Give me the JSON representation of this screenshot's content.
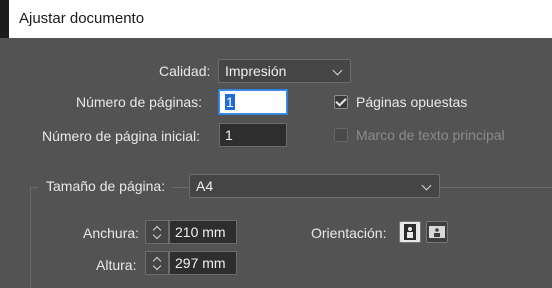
{
  "window": {
    "title": "Ajustar documento"
  },
  "quality": {
    "label": "Calidad:",
    "value": "Impresión"
  },
  "pages": {
    "label": "Número de páginas:",
    "value": "1"
  },
  "start_page": {
    "label": "Número de página inicial:",
    "value": "1"
  },
  "facing_pages": {
    "label": "Páginas opuestas",
    "checked": true
  },
  "primary_text_frame": {
    "label": "Marco de texto principal",
    "checked": false,
    "enabled": false
  },
  "page_size": {
    "label": "Tamaño de página:",
    "value": "A4"
  },
  "width": {
    "label": "Anchura:",
    "value": "210 mm"
  },
  "height": {
    "label": "Altura:",
    "value": "297 mm"
  },
  "orientation": {
    "label": "Orientación:",
    "selected": "portrait"
  },
  "icons": [
    "chevron-down-icon",
    "check-icon",
    "stepper-icon",
    "portrait-icon",
    "landscape-icon"
  ]
}
